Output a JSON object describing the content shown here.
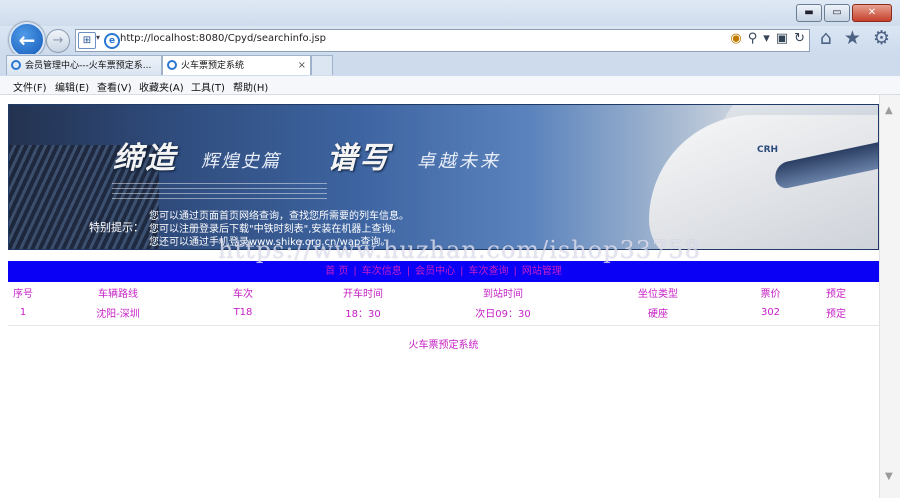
{
  "window": {
    "minimize_label": "▬",
    "maximize_label": "▭",
    "close_label": "✕"
  },
  "address_bar": {
    "url": "http://localhost:8080/Cpyd/searchinfo.jsp"
  },
  "tabs": [
    {
      "label": "会员管理中心---火车票预定系..."
    },
    {
      "label": "火车票预定系统",
      "active": true
    }
  ],
  "menu": [
    "文件(F)",
    "编辑(E)",
    "查看(V)",
    "收藏夹(A)",
    "工具(T)",
    "帮助(H)"
  ],
  "banner": {
    "slogan_big_1": "缔造",
    "slogan_small_1": "辉煌史篇",
    "slogan_big_2": "谱写",
    "slogan_small_2": "卓越未来",
    "tip_label": "特别提示：",
    "tip_lines": [
      "您可以通过页面首页网络查询，查找您所需要的列车信息。",
      "您可以注册登录后下载\"中铁时刻表\",安装在机器上查询。",
      "您还可以通过手机登录www.shike.org.cn/wap查询。"
    ],
    "train_mark": "CRH"
  },
  "nav": {
    "items": [
      "首  页",
      "车次信息",
      "会员中心",
      "车次查询",
      "网站管理"
    ],
    "separator": "|"
  },
  "results_table": {
    "headers": [
      "序号",
      "车辆路线",
      "车次",
      "开车时间",
      "到站时间",
      "坐位类型",
      "票价",
      "预定"
    ],
    "rows": [
      [
        "1",
        "沈阳-深圳",
        "T18",
        "18：30",
        "次日09：30",
        "硬座",
        "302",
        "预定"
      ]
    ]
  },
  "footer": {
    "text": "火车票预定系统"
  },
  "watermark": "https://www.huzhan.com/ishop33758",
  "colors": {
    "nav_background": "#0a00f5",
    "link_text": "#c61fc6"
  }
}
